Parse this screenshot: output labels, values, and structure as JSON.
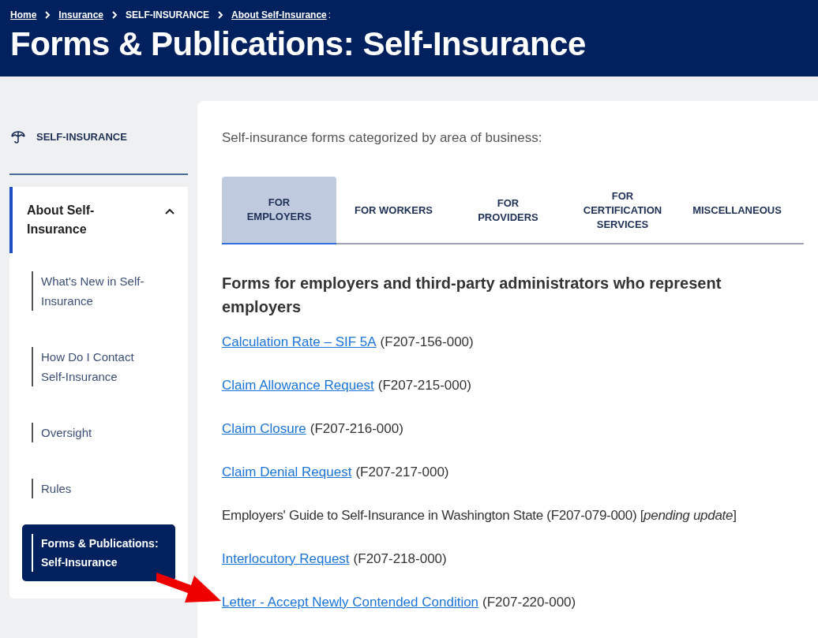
{
  "breadcrumbs": [
    {
      "label": "Home",
      "link": true
    },
    {
      "label": "Insurance",
      "link": true
    },
    {
      "label": "SELF-INSURANCE",
      "link": false
    },
    {
      "label": "About Self-Insurance",
      "link": true
    }
  ],
  "breadcrumb_end": ":",
  "page_title": "Forms & Publications: Self-Insurance",
  "sidebar": {
    "heading": "SELF-INSURANCE",
    "section": {
      "label": "About Self-Insurance",
      "expanded": true,
      "children": [
        {
          "label": "What's New in Self-Insurance",
          "selected": false
        },
        {
          "label": "How Do I Contact Self-Insurance",
          "selected": false
        },
        {
          "label": "Oversight",
          "selected": false
        },
        {
          "label": "Rules",
          "selected": false
        },
        {
          "label": "Forms & Publications: Self-Insurance",
          "selected": true
        }
      ]
    }
  },
  "intro": "Self-insurance forms categorized by area of business:",
  "tabs": [
    {
      "label": "FOR EMPLOYERS",
      "selected": true
    },
    {
      "label": "FOR WORKERS",
      "selected": false
    },
    {
      "label": "FOR PROVIDERS",
      "selected": false
    },
    {
      "label": "FOR CERTIFICATION SERVICES",
      "selected": false
    },
    {
      "label": "MISCELLANEOUS",
      "selected": false
    }
  ],
  "section_heading": "Forms for employers and third-party administrators who represent employers",
  "forms": [
    {
      "kind": "link",
      "title": "Calculation Rate – SIF 5A",
      "code": "(F207-156-000)"
    },
    {
      "kind": "link",
      "title": "Claim Allowance Request",
      "code": "(F207-215-000)"
    },
    {
      "kind": "link",
      "title": "Claim Closure",
      "code": "(F207-216-000)"
    },
    {
      "kind": "link",
      "title": "Claim Denial Request",
      "code": "(F207-217-000)"
    },
    {
      "kind": "text",
      "title": "Employers' Guide to Self-Insurance in Washington State (F207-079-000) [*pending update*]"
    },
    {
      "kind": "link",
      "title": "Interlocutory Request",
      "code": "(F207-218-000)"
    },
    {
      "kind": "link",
      "title": "Letter - Accept Newly Contended Condition",
      "code": "(F207-220-000)"
    }
  ]
}
